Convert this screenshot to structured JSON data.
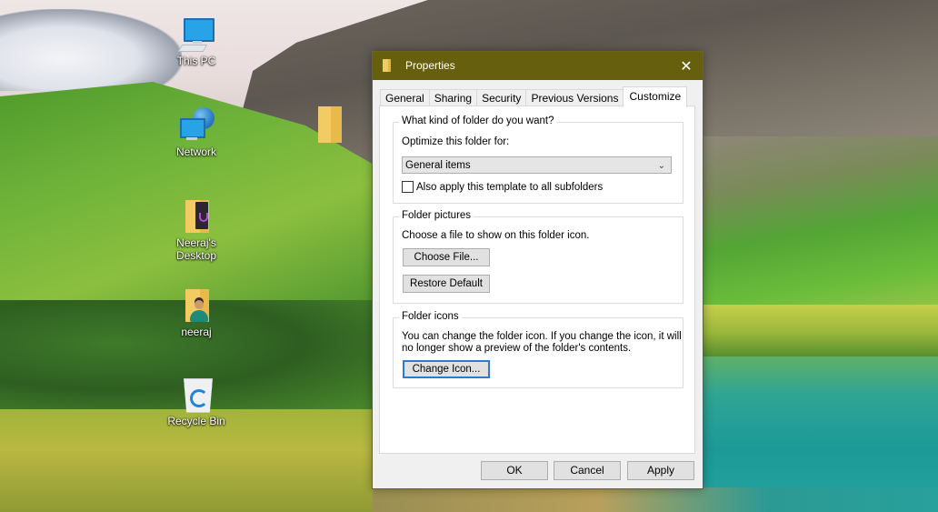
{
  "desktop": {
    "icons": [
      {
        "label": "This PC",
        "icon": "computer-icon"
      },
      {
        "label": "Network",
        "icon": "network-icon"
      },
      {
        "label": "Neeraj's Desktop",
        "icon": "folder-icon"
      },
      {
        "label": "neeraj",
        "icon": "user-folder-icon"
      },
      {
        "label": "Recycle Bin",
        "icon": "recycle-bin-icon"
      }
    ],
    "loose_folder": {
      "icon": "folder-icon",
      "label": ""
    }
  },
  "dialog": {
    "title": "Properties",
    "title_icon": "folder-icon",
    "titlebar_color": "#66600e",
    "close_glyph": "✕",
    "tabs": [
      {
        "label": "General",
        "active": false
      },
      {
        "label": "Sharing",
        "active": false
      },
      {
        "label": "Security",
        "active": false
      },
      {
        "label": "Previous Versions",
        "active": false
      },
      {
        "label": "Customize",
        "active": true
      }
    ],
    "sections": {
      "folder_type": {
        "legend": "What kind of folder do you want?",
        "optimize_label": "Optimize this folder for:",
        "optimize_value": "General items",
        "apply_subfolders_label": "Also apply this template to all subfolders",
        "apply_subfolders_checked": false
      },
      "folder_pictures": {
        "legend": "Folder pictures",
        "description": "Choose a file to show on this folder icon.",
        "choose_file_label": "Choose File...",
        "restore_default_label": "Restore Default"
      },
      "folder_icons": {
        "legend": "Folder icons",
        "description_line1": "You can change the folder icon. If you change the icon, it will",
        "description_line2": "no longer show a preview of the folder's contents.",
        "change_icon_label": "Change Icon..."
      }
    },
    "footer": {
      "ok_label": "OK",
      "cancel_label": "Cancel",
      "apply_label": "Apply"
    }
  }
}
